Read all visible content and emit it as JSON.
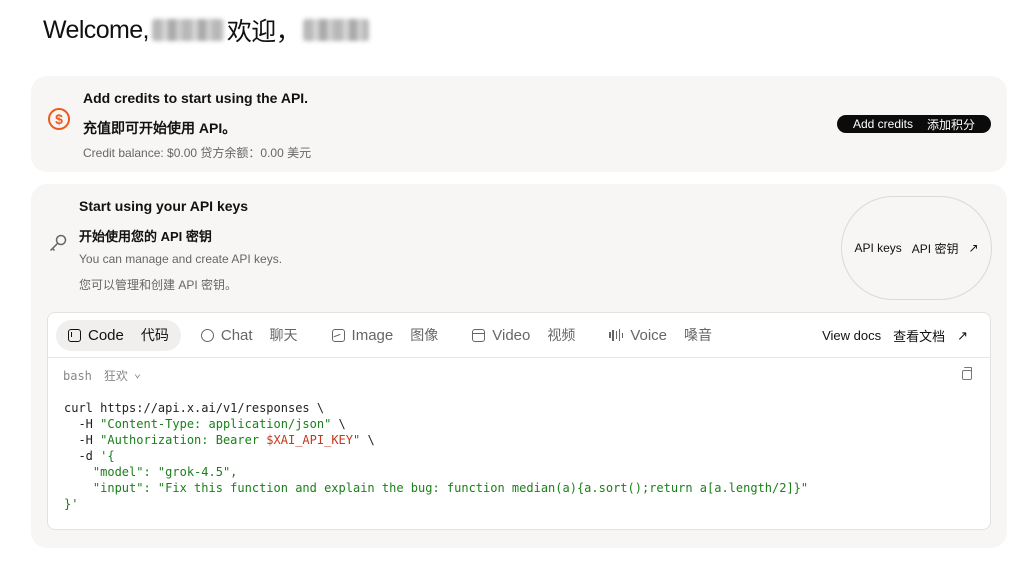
{
  "welcome": {
    "greeting": "Welcome,",
    "greeting_cn": "欢迎，"
  },
  "credits_card": {
    "title": "Add credits to start using the API.",
    "title_cn": "充值即可开始使用 API。",
    "balance": "Credit balance: $0.00  贷方余额：0.00 美元",
    "button_label": "Add credits",
    "button_label_cn": "添加积分",
    "icon": "dollar-circle-icon",
    "accent_color": "#ee5a1d"
  },
  "api_card": {
    "title": "Start using your API keys",
    "title_cn": "开始使用您的 API 密钥",
    "description": "You can manage and create API keys.",
    "description_cn": "您可以管理和创建 API 密钥。",
    "button_label": "API keys",
    "button_label_cn": "API 密钥",
    "button_arrow": "↗",
    "icon": "key-icon"
  },
  "code_panel": {
    "tabs": [
      {
        "label": "Code",
        "label_cn": "代码",
        "icon": "code-icon",
        "active": true
      },
      {
        "label": "Chat",
        "label_cn": "聊天",
        "icon": "chat-icon",
        "active": false
      },
      {
        "label": "Image",
        "label_cn": "图像",
        "icon": "image-icon",
        "active": false
      },
      {
        "label": "Video",
        "label_cn": "视频",
        "icon": "video-icon",
        "active": false
      },
      {
        "label": "Voice",
        "label_cn": "嗓音",
        "icon": "voice-icon",
        "active": false
      }
    ],
    "view_docs": "View docs",
    "view_docs_cn": "查看文档",
    "view_docs_arrow": "↗",
    "language": "bash",
    "language_cn": "狂欢",
    "language_chevron": "⌄",
    "code_lines": [
      "curl https://api.x.ai/v1/responses \\",
      "  -H \"Content-Type: application/json\" \\",
      "  -H \"Authorization: Bearer $XAI_API_KEY\" \\",
      "  -d '{",
      "    \"model\": \"grok-4.5\",",
      "    \"input\": \"Fix this function and explain the bug: function median(a){a.sort();return a[a.length/2]}\"",
      "}'"
    ]
  }
}
